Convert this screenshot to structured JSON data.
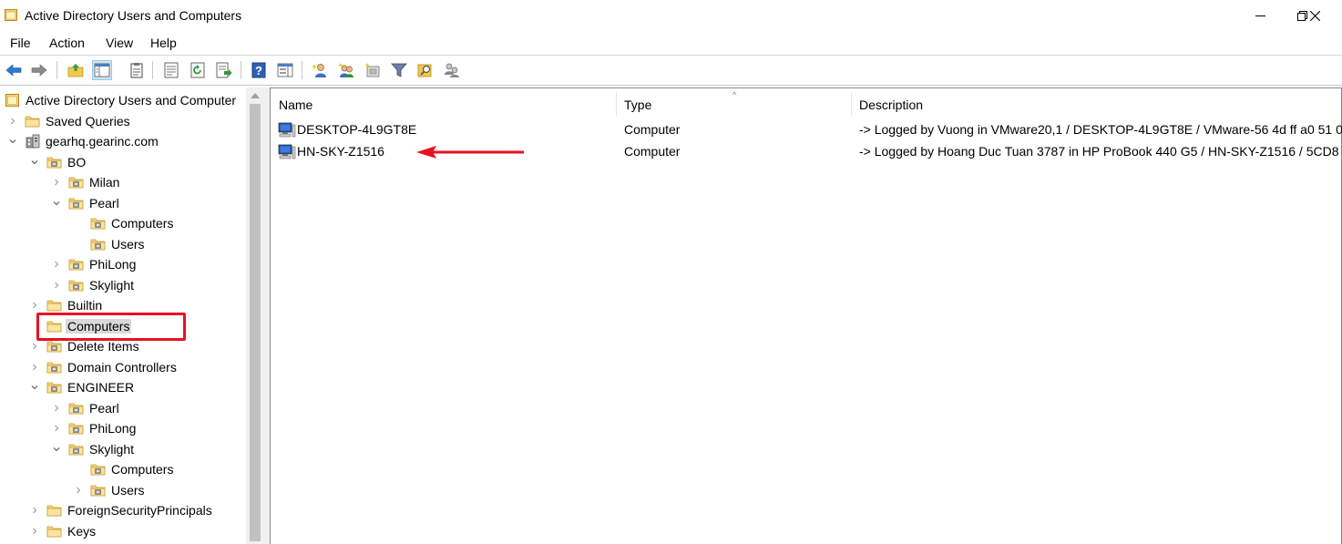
{
  "window": {
    "title": "Active Directory Users and Computers",
    "app_icon": "aduc-icon",
    "controls": [
      "minimize-icon",
      "restore-icon",
      "close-icon"
    ]
  },
  "menu": {
    "file": "File",
    "action": "Action",
    "view": "View",
    "help": "Help"
  },
  "toolbar": {
    "buttons": [
      "back-arrow-icon",
      "forward-arrow-icon",
      "up-folder-icon",
      "show-console-tree-icon",
      "clipboard-icon",
      "properties-icon",
      "refresh-icon",
      "export-list-icon",
      "help-icon",
      "action-pane-icon",
      "new-user-icon",
      "new-group-icon",
      "new-ou-icon",
      "filter-icon",
      "find-icon",
      "add-to-group-icon"
    ]
  },
  "tree": {
    "root": "Active Directory Users and Computer",
    "saved_queries": "Saved Queries",
    "domain": "gearhq.gearinc.com",
    "bo": "BO",
    "bo_milan": "Milan",
    "bo_pearl": "Pearl",
    "bo_pearl_computers": "Computers",
    "bo_pearl_users": "Users",
    "bo_philong": "PhiLong",
    "bo_skylight": "Skylight",
    "builtin": "Builtin",
    "computers": "Computers",
    "delete_items": "Delete Items",
    "domain_controllers": "Domain Controllers",
    "engineer": "ENGINEER",
    "eng_pearl": "Pearl",
    "eng_philong": "PhiLong",
    "eng_skylight": "Skylight",
    "eng_skylight_computers": "Computers",
    "eng_skylight_users": "Users",
    "foreign_security_principals": "ForeignSecurityPrincipals",
    "keys": "Keys",
    "selected": "Computers"
  },
  "list": {
    "columns": {
      "name": "Name",
      "type": "Type",
      "description": "Description"
    },
    "sorted_column": "Type",
    "rows": [
      {
        "name": "DESKTOP-4L9GT8E",
        "type": "Computer",
        "description": "-> Logged by Vuong in VMware20,1 / DESKTOP-4L9GT8E / VMware-56 4d ff a0 51 0"
      },
      {
        "name": "HN-SKY-Z1516",
        "type": "Computer",
        "description": "-> Logged by Hoang Duc Tuan 3787 in HP ProBook 440 G5 / HN-SKY-Z1516 / 5CD8"
      }
    ]
  },
  "annotations": {
    "color": "#e81123",
    "box_around": "Computers",
    "arrow_points_to": "HN-SKY-Z1516"
  }
}
